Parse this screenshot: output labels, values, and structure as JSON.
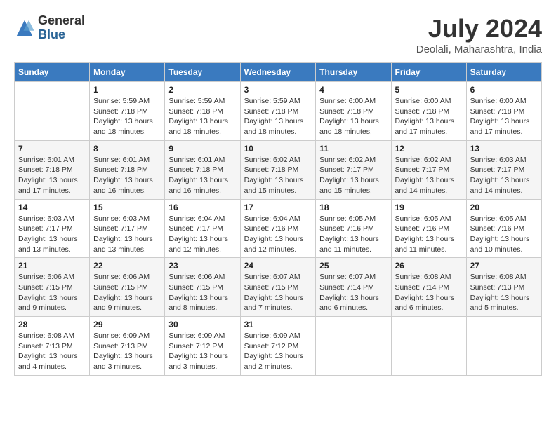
{
  "header": {
    "logo_line1": "General",
    "logo_line2": "Blue",
    "month_year": "July 2024",
    "location": "Deolali, Maharashtra, India"
  },
  "weekdays": [
    "Sunday",
    "Monday",
    "Tuesday",
    "Wednesday",
    "Thursday",
    "Friday",
    "Saturday"
  ],
  "weeks": [
    [
      {
        "day": "",
        "sunrise": "",
        "sunset": "",
        "daylight": ""
      },
      {
        "day": "1",
        "sunrise": "Sunrise: 5:59 AM",
        "sunset": "Sunset: 7:18 PM",
        "daylight": "Daylight: 13 hours and 18 minutes."
      },
      {
        "day": "2",
        "sunrise": "Sunrise: 5:59 AM",
        "sunset": "Sunset: 7:18 PM",
        "daylight": "Daylight: 13 hours and 18 minutes."
      },
      {
        "day": "3",
        "sunrise": "Sunrise: 5:59 AM",
        "sunset": "Sunset: 7:18 PM",
        "daylight": "Daylight: 13 hours and 18 minutes."
      },
      {
        "day": "4",
        "sunrise": "Sunrise: 6:00 AM",
        "sunset": "Sunset: 7:18 PM",
        "daylight": "Daylight: 13 hours and 18 minutes."
      },
      {
        "day": "5",
        "sunrise": "Sunrise: 6:00 AM",
        "sunset": "Sunset: 7:18 PM",
        "daylight": "Daylight: 13 hours and 17 minutes."
      },
      {
        "day": "6",
        "sunrise": "Sunrise: 6:00 AM",
        "sunset": "Sunset: 7:18 PM",
        "daylight": "Daylight: 13 hours and 17 minutes."
      }
    ],
    [
      {
        "day": "7",
        "sunrise": "Sunrise: 6:01 AM",
        "sunset": "Sunset: 7:18 PM",
        "daylight": "Daylight: 13 hours and 17 minutes."
      },
      {
        "day": "8",
        "sunrise": "Sunrise: 6:01 AM",
        "sunset": "Sunset: 7:18 PM",
        "daylight": "Daylight: 13 hours and 16 minutes."
      },
      {
        "day": "9",
        "sunrise": "Sunrise: 6:01 AM",
        "sunset": "Sunset: 7:18 PM",
        "daylight": "Daylight: 13 hours and 16 minutes."
      },
      {
        "day": "10",
        "sunrise": "Sunrise: 6:02 AM",
        "sunset": "Sunset: 7:18 PM",
        "daylight": "Daylight: 13 hours and 15 minutes."
      },
      {
        "day": "11",
        "sunrise": "Sunrise: 6:02 AM",
        "sunset": "Sunset: 7:17 PM",
        "daylight": "Daylight: 13 hours and 15 minutes."
      },
      {
        "day": "12",
        "sunrise": "Sunrise: 6:02 AM",
        "sunset": "Sunset: 7:17 PM",
        "daylight": "Daylight: 13 hours and 14 minutes."
      },
      {
        "day": "13",
        "sunrise": "Sunrise: 6:03 AM",
        "sunset": "Sunset: 7:17 PM",
        "daylight": "Daylight: 13 hours and 14 minutes."
      }
    ],
    [
      {
        "day": "14",
        "sunrise": "Sunrise: 6:03 AM",
        "sunset": "Sunset: 7:17 PM",
        "daylight": "Daylight: 13 hours and 13 minutes."
      },
      {
        "day": "15",
        "sunrise": "Sunrise: 6:03 AM",
        "sunset": "Sunset: 7:17 PM",
        "daylight": "Daylight: 13 hours and 13 minutes."
      },
      {
        "day": "16",
        "sunrise": "Sunrise: 6:04 AM",
        "sunset": "Sunset: 7:17 PM",
        "daylight": "Daylight: 13 hours and 12 minutes."
      },
      {
        "day": "17",
        "sunrise": "Sunrise: 6:04 AM",
        "sunset": "Sunset: 7:16 PM",
        "daylight": "Daylight: 13 hours and 12 minutes."
      },
      {
        "day": "18",
        "sunrise": "Sunrise: 6:05 AM",
        "sunset": "Sunset: 7:16 PM",
        "daylight": "Daylight: 13 hours and 11 minutes."
      },
      {
        "day": "19",
        "sunrise": "Sunrise: 6:05 AM",
        "sunset": "Sunset: 7:16 PM",
        "daylight": "Daylight: 13 hours and 11 minutes."
      },
      {
        "day": "20",
        "sunrise": "Sunrise: 6:05 AM",
        "sunset": "Sunset: 7:16 PM",
        "daylight": "Daylight: 13 hours and 10 minutes."
      }
    ],
    [
      {
        "day": "21",
        "sunrise": "Sunrise: 6:06 AM",
        "sunset": "Sunset: 7:15 PM",
        "daylight": "Daylight: 13 hours and 9 minutes."
      },
      {
        "day": "22",
        "sunrise": "Sunrise: 6:06 AM",
        "sunset": "Sunset: 7:15 PM",
        "daylight": "Daylight: 13 hours and 9 minutes."
      },
      {
        "day": "23",
        "sunrise": "Sunrise: 6:06 AM",
        "sunset": "Sunset: 7:15 PM",
        "daylight": "Daylight: 13 hours and 8 minutes."
      },
      {
        "day": "24",
        "sunrise": "Sunrise: 6:07 AM",
        "sunset": "Sunset: 7:15 PM",
        "daylight": "Daylight: 13 hours and 7 minutes."
      },
      {
        "day": "25",
        "sunrise": "Sunrise: 6:07 AM",
        "sunset": "Sunset: 7:14 PM",
        "daylight": "Daylight: 13 hours and 6 minutes."
      },
      {
        "day": "26",
        "sunrise": "Sunrise: 6:08 AM",
        "sunset": "Sunset: 7:14 PM",
        "daylight": "Daylight: 13 hours and 6 minutes."
      },
      {
        "day": "27",
        "sunrise": "Sunrise: 6:08 AM",
        "sunset": "Sunset: 7:13 PM",
        "daylight": "Daylight: 13 hours and 5 minutes."
      }
    ],
    [
      {
        "day": "28",
        "sunrise": "Sunrise: 6:08 AM",
        "sunset": "Sunset: 7:13 PM",
        "daylight": "Daylight: 13 hours and 4 minutes."
      },
      {
        "day": "29",
        "sunrise": "Sunrise: 6:09 AM",
        "sunset": "Sunset: 7:13 PM",
        "daylight": "Daylight: 13 hours and 3 minutes."
      },
      {
        "day": "30",
        "sunrise": "Sunrise: 6:09 AM",
        "sunset": "Sunset: 7:12 PM",
        "daylight": "Daylight: 13 hours and 3 minutes."
      },
      {
        "day": "31",
        "sunrise": "Sunrise: 6:09 AM",
        "sunset": "Sunset: 7:12 PM",
        "daylight": "Daylight: 13 hours and 2 minutes."
      },
      {
        "day": "",
        "sunrise": "",
        "sunset": "",
        "daylight": ""
      },
      {
        "day": "",
        "sunrise": "",
        "sunset": "",
        "daylight": ""
      },
      {
        "day": "",
        "sunrise": "",
        "sunset": "",
        "daylight": ""
      }
    ]
  ]
}
